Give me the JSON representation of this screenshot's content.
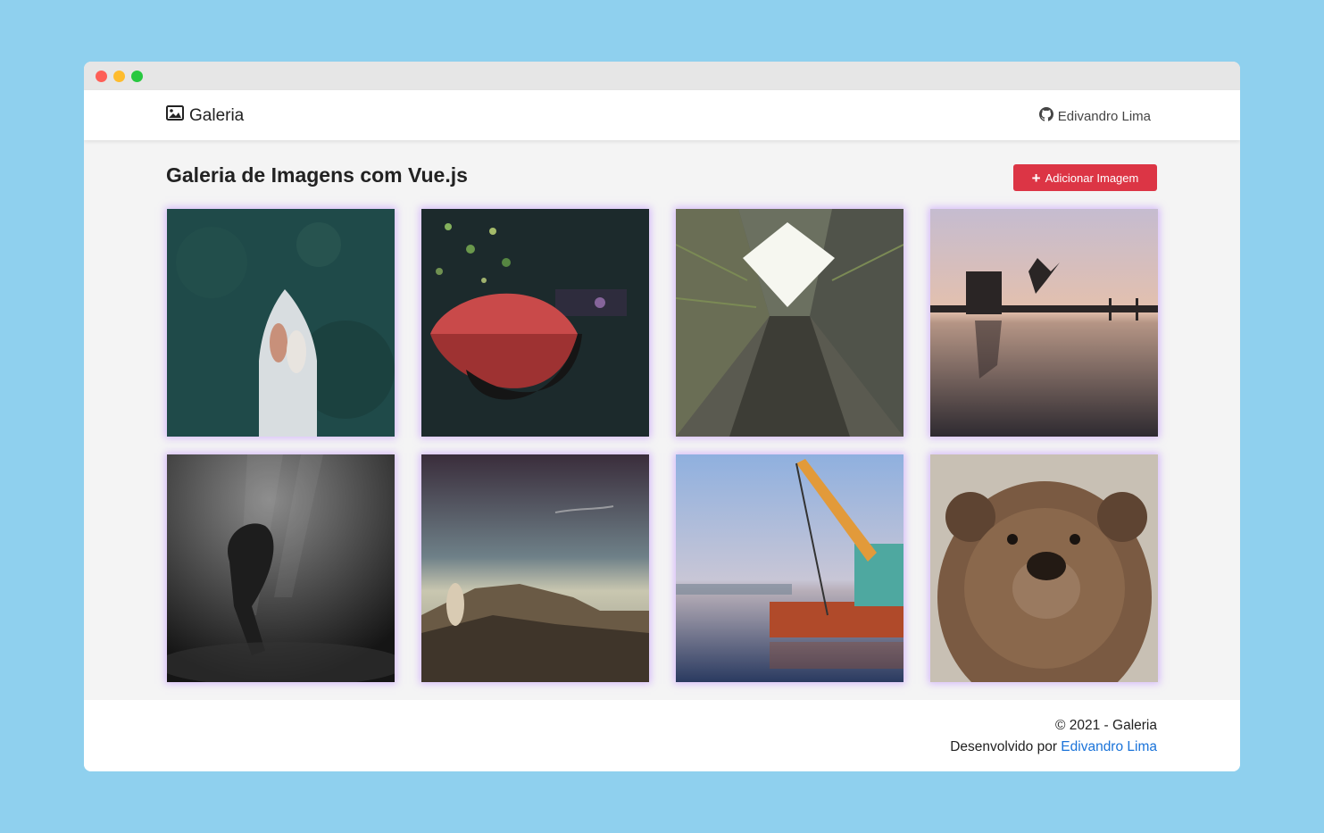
{
  "navbar": {
    "brand": "Galeria",
    "author_link": "Edivandro Lima"
  },
  "main": {
    "title": "Galeria de Imagens com Vue.js",
    "add_button": "Adicionar Imagem"
  },
  "gallery": [
    "aerial-boat-couple",
    "red-umbrella-night",
    "building-courtyard-skyward",
    "jumping-pier-sunset",
    "underwater-diver-bw",
    "cliff-figure-sky",
    "harbor-crane-ship",
    "brown-bear-portrait"
  ],
  "footer": {
    "copyright": "© 2021 - Galeria",
    "developed_by": "Desenvolvido por ",
    "developer_link": "Edivandro Lima"
  },
  "colors": {
    "background": "#8fd0ee",
    "primary_button": "#dc3545",
    "link": "#1a73d9",
    "tile_glow": "#be8cff"
  }
}
